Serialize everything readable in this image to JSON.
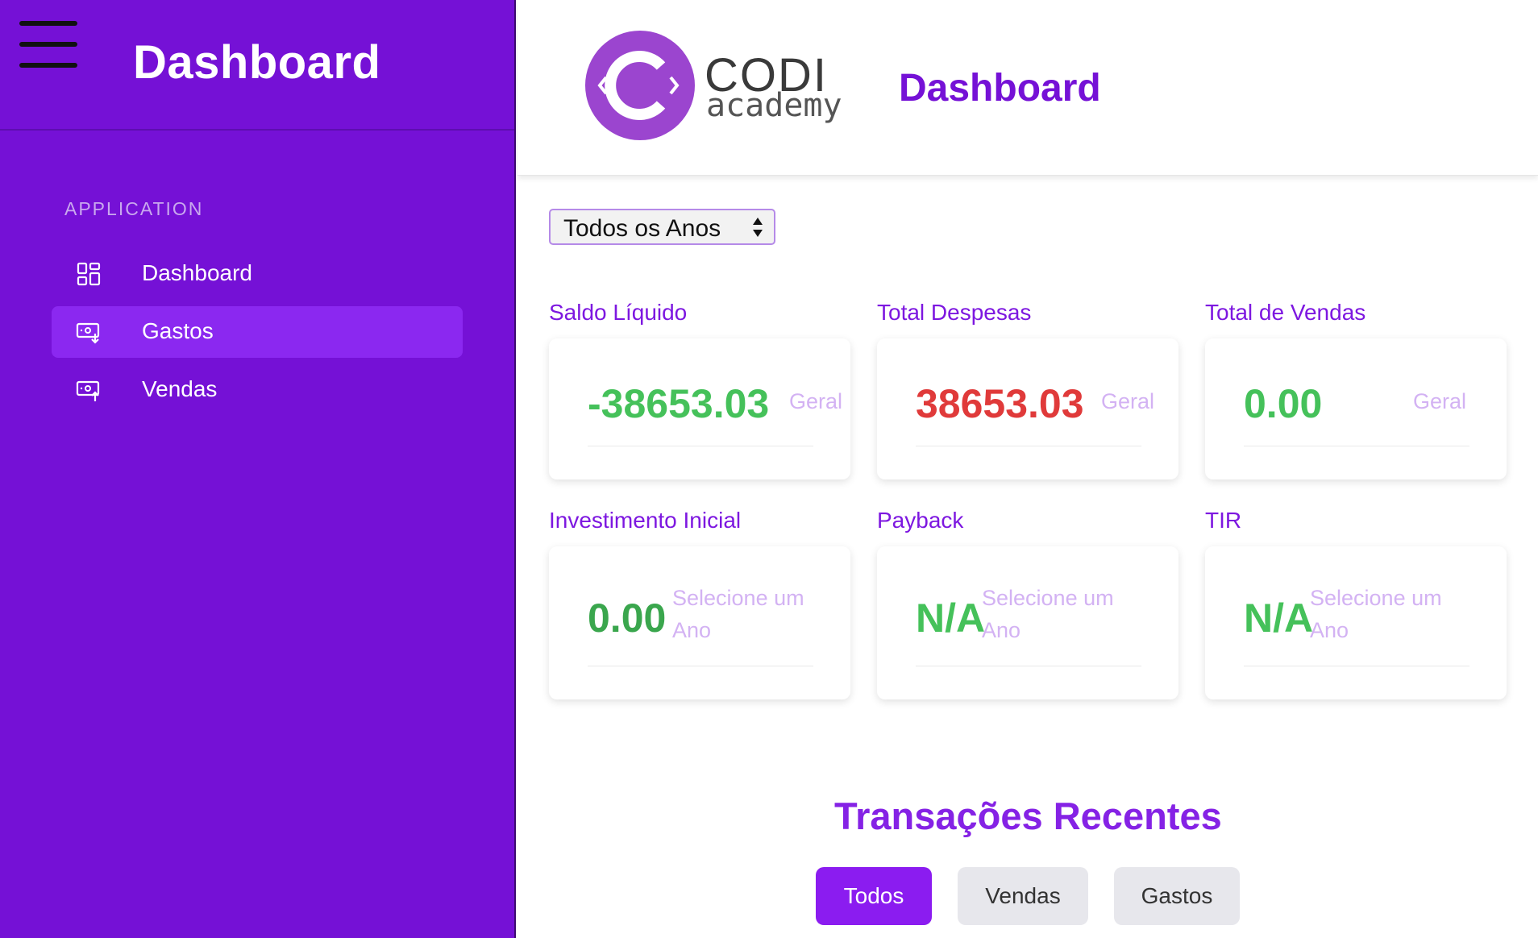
{
  "sidebar": {
    "title": "Dashboard",
    "section_label": "APPLICATION",
    "items": [
      {
        "label": "Dashboard",
        "icon": "grid-icon"
      },
      {
        "label": "Gastos",
        "icon": "money-down-icon",
        "active": true
      },
      {
        "label": "Vendas",
        "icon": "money-up-icon"
      }
    ]
  },
  "header": {
    "logo_text_1": "CODI",
    "logo_text_2": "academy",
    "title": "Dashboard"
  },
  "filter": {
    "year_select": "Todos os Anos"
  },
  "cards": [
    {
      "label": "Saldo Líquido",
      "value": "-38653.03",
      "sub": "Geral",
      "color": "#45c15a"
    },
    {
      "label": "Total Despesas",
      "value": "38653.03",
      "sub": "Geral",
      "color": "#e03a3a"
    },
    {
      "label": "Total de Vendas",
      "value": "0.00",
      "sub": "Geral",
      "color": "#45c15a"
    },
    {
      "label": "Investimento Inicial",
      "value": "0.00",
      "sub": "Selecione um Ano",
      "color": "#3aa64d"
    },
    {
      "label": "Payback",
      "value": "N/A",
      "sub": "Selecione um Ano",
      "color": "#45c15a"
    },
    {
      "label": "TIR",
      "value": "N/A",
      "sub": "Selecione um Ano",
      "color": "#45c15a"
    }
  ],
  "recent": {
    "title": "Transações Recentes",
    "tabs": [
      {
        "label": "Todos",
        "active": true
      },
      {
        "label": "Vendas"
      },
      {
        "label": "Gastos"
      }
    ]
  },
  "colors": {
    "sidebar_bg": "#7511d6",
    "active_item": "#8b28f0",
    "accent": "#7511d6",
    "positive": "#45c15a",
    "negative": "#e03a3a"
  }
}
